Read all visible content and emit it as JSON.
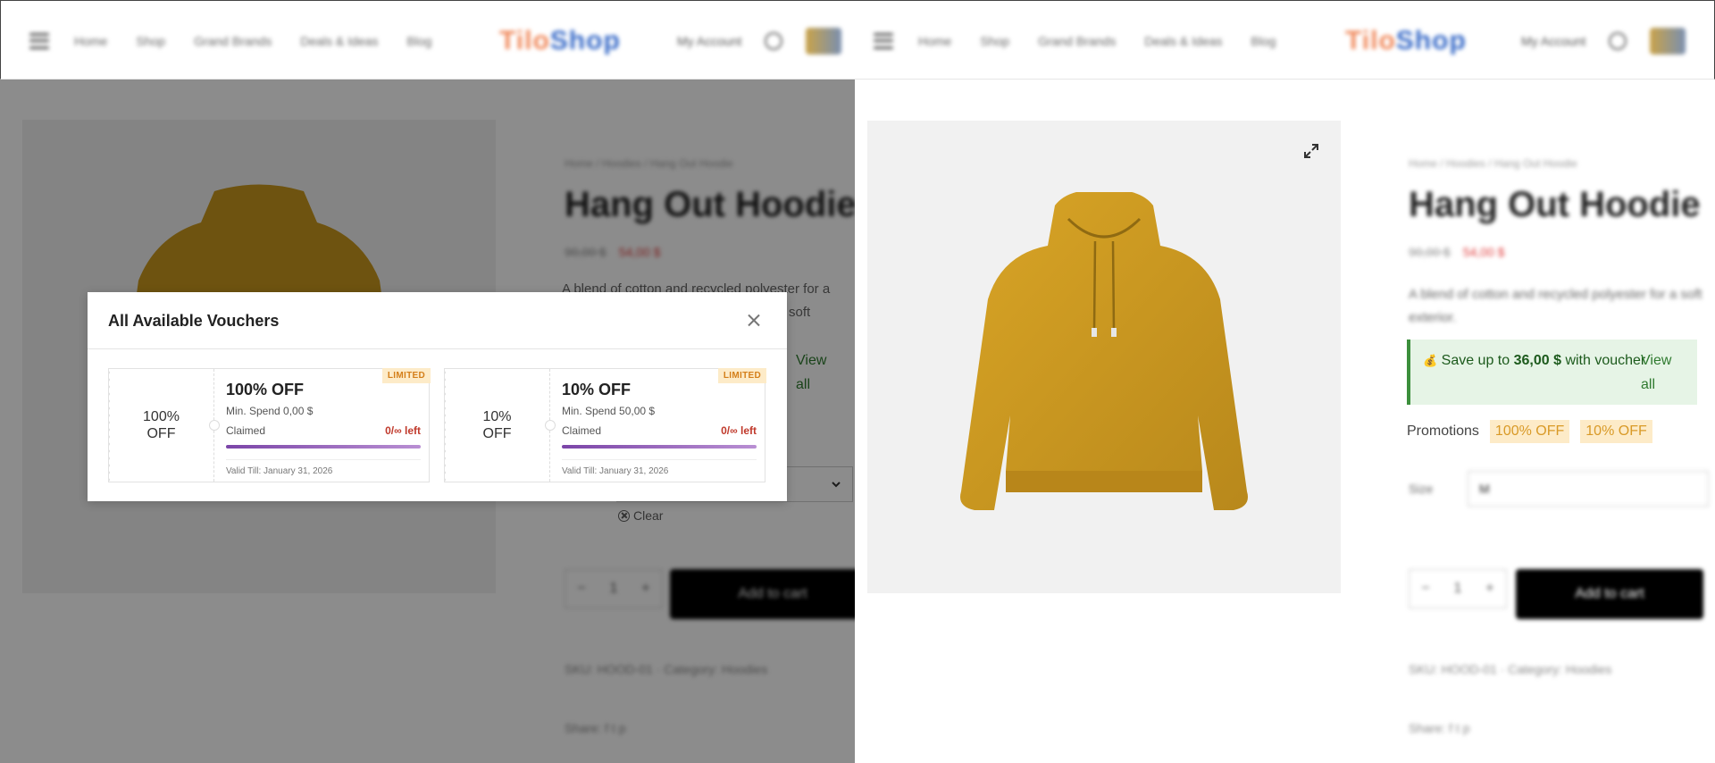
{
  "header": {
    "nav_items": [
      "Home",
      "Shop",
      "Grand Brands",
      "Deals & Ideas",
      "Blog"
    ],
    "logo_a": "Tilo",
    "logo_b": "Shop",
    "account": "My Account"
  },
  "product": {
    "breadcrumb": "Home / Hoodies / Hang Out Hoodie",
    "title": "Hang Out Hoodie",
    "old_price": "90,00 $",
    "new_price": "54,00 $",
    "description": "A blend of cotton and recycled polyester for a soft exterior.",
    "description_line1": "A blend of cotton and recycled polyester for a",
    "description_line2": "soft exterior."
  },
  "savings": {
    "prefix": "Save up to",
    "amount": "36,00 $",
    "suffix": "with voucher",
    "view_all_line1": "View",
    "view_all_line2": "all"
  },
  "promotions": {
    "label": "Promotions",
    "tags": [
      "100% OFF",
      "10% OFF"
    ]
  },
  "size": {
    "label": "Size",
    "value": "M"
  },
  "clear_label": "Clear",
  "buttons": {
    "add_to_cart": "Add to cart"
  },
  "modal": {
    "title": "All Available Vouchers",
    "vouchers": [
      {
        "left_label_1": "100%",
        "left_label_2": "OFF",
        "title": "100% OFF",
        "min_spend": "Min. Spend 0,00 $",
        "claimed_label": "Claimed",
        "left_count": "0/∞ left",
        "claimed_fraction": 1.0,
        "valid_till": "Valid Till: January 31, 2026",
        "badge": "LIMITED"
      },
      {
        "left_label_1": "10%",
        "left_label_2": "OFF",
        "title": "10% OFF",
        "min_spend": "Min. Spend 50,00 $",
        "claimed_label": "Claimed",
        "left_count": "0/∞ left",
        "claimed_fraction": 1.0,
        "valid_till": "Valid Till: January 31, 2026",
        "badge": "LIMITED"
      }
    ]
  },
  "colors": {
    "accent_green": "#3c8f3c",
    "promo_tag_bg": "#fdebc8",
    "promo_tag_text": "#d99a27",
    "progress_purple": "#7b45a8",
    "left_count_red": "#c0392b"
  }
}
